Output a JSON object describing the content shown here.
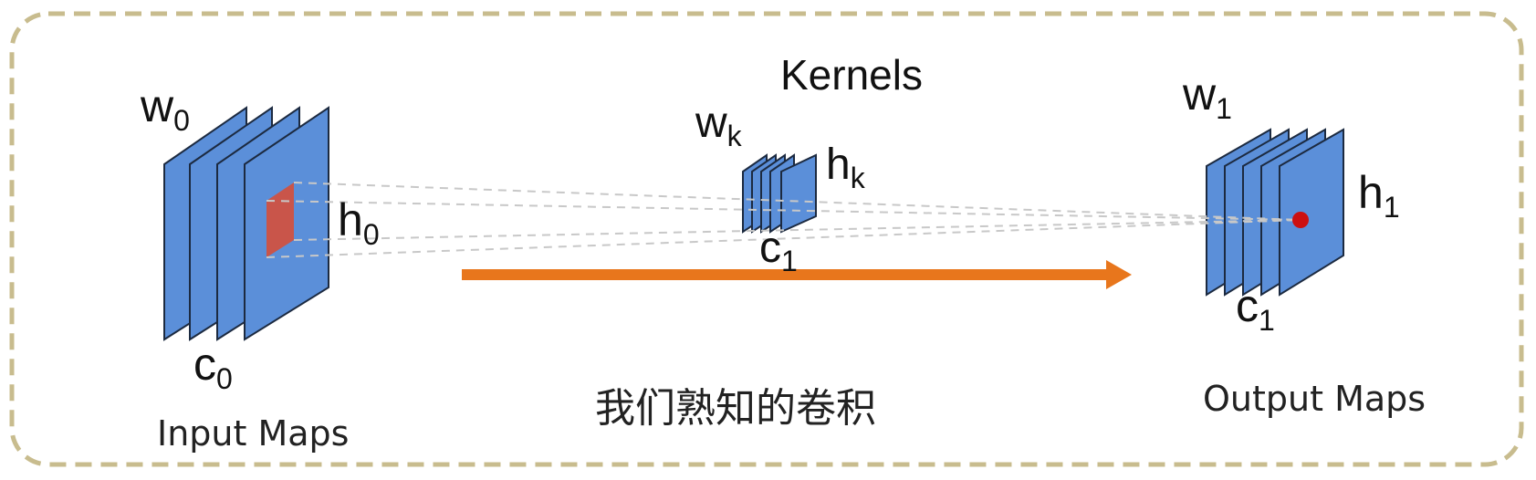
{
  "colors": {
    "frame": "#c8bc8e",
    "map_fill": "#5b8fd9",
    "map_stroke": "#1c2a40",
    "patch": "#c9554a",
    "arrow": "#e8761c",
    "guide": "#c8c8c8",
    "point": "#cc1010"
  },
  "input": {
    "w": {
      "base": "w",
      "sub": "0"
    },
    "h": {
      "base": "h",
      "sub": "0"
    },
    "c": {
      "base": "c",
      "sub": "0"
    },
    "caption": "Input Maps"
  },
  "kernel": {
    "title": "Kernels",
    "w": {
      "base": "w",
      "sub": "k"
    },
    "h": {
      "base": "h",
      "sub": "k"
    },
    "c": {
      "base": "c",
      "sub": "1"
    }
  },
  "output": {
    "w": {
      "base": "w",
      "sub": "1"
    },
    "h": {
      "base": "h",
      "sub": "1"
    },
    "c": {
      "base": "c",
      "sub": "1"
    },
    "caption": "Output Maps"
  },
  "center_caption": "我们熟知的卷积"
}
